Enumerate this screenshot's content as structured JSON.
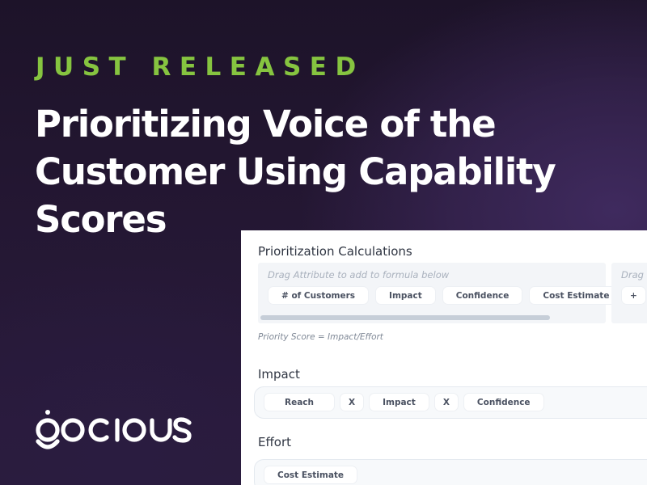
{
  "promo": {
    "kicker": "JUST RELEASED",
    "headline_lines": [
      "Prioritizing Voice of the",
      "Customer Using Capability",
      "Scores"
    ],
    "brand": "gocious",
    "colors": {
      "accent_green": "#86c440",
      "background": "#241733",
      "headline": "#ffffff"
    }
  },
  "app": {
    "section_title": "Prioritization Calculations",
    "attribute_area": {
      "hint": "Drag Attribute to add to formula below",
      "chips": [
        "# of Customers",
        "Impact",
        "Confidence",
        "Cost Estimate"
      ]
    },
    "operator_area": {
      "hint": "Drag Operator",
      "chips": [
        "+"
      ]
    },
    "formula_caption": "Priority Score = Impact/Effort",
    "impact": {
      "label": "Impact",
      "tokens": [
        "Reach",
        "X",
        "Impact",
        "X",
        "Confidence"
      ]
    },
    "effort": {
      "label": "Effort",
      "tokens": [
        "Cost Estimate"
      ]
    }
  }
}
